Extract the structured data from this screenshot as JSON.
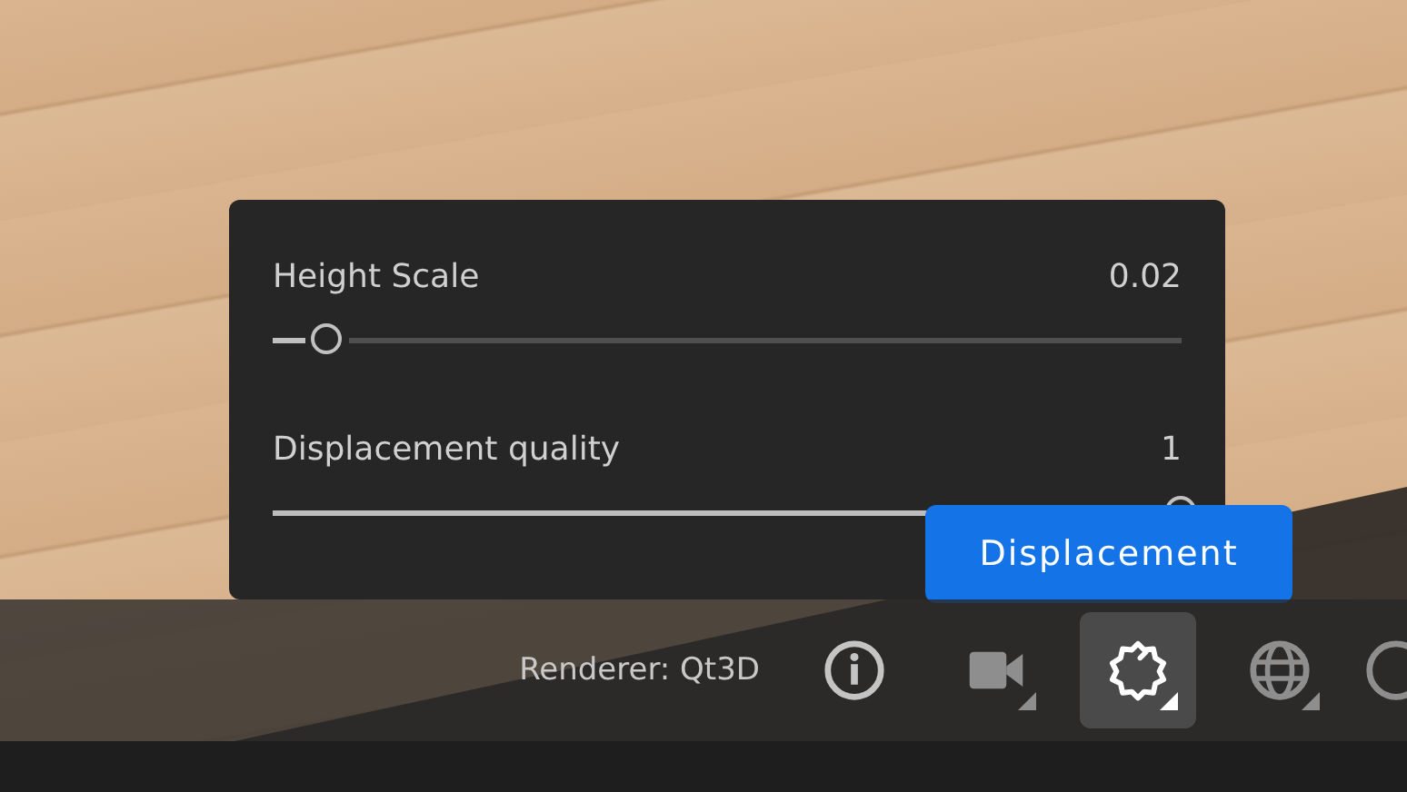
{
  "panel": {
    "sliders": [
      {
        "label": "Height Scale",
        "value": "0.02",
        "level": 0.06,
        "kind": "split"
      },
      {
        "label": "Displacement quality",
        "value": "1",
        "level": 1,
        "kind": "filled"
      }
    ]
  },
  "tooltip": {
    "text": "Displacement"
  },
  "toolbar": {
    "renderer": "Renderer: Qt3D",
    "buttons": [
      {
        "kind": "info",
        "selected": false,
        "menu": false
      },
      {
        "kind": "camera",
        "selected": false,
        "menu": true
      },
      {
        "kind": "displacement",
        "selected": true,
        "menu": true
      },
      {
        "kind": "globe",
        "selected": false,
        "menu": true
      },
      {
        "kind": "partial",
        "selected": false,
        "menu": false
      }
    ]
  }
}
